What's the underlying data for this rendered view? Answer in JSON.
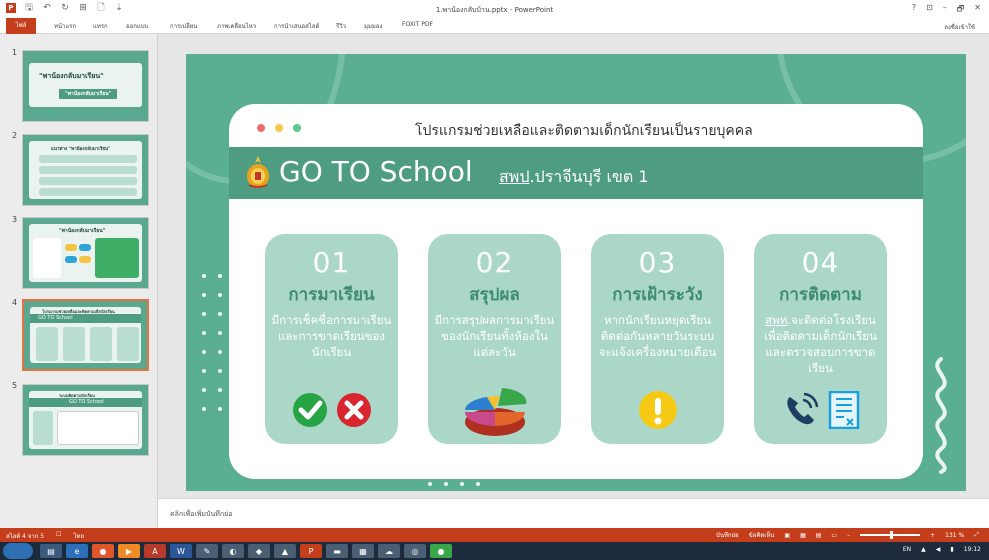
{
  "window": {
    "title": "1.พาน้องกลับบ้าน.pptx - PowerPoint",
    "help": "?",
    "restore_ribbon": "⊡",
    "minimize": "–",
    "maximize": "🗗",
    "close": "✕"
  },
  "quick_access": {
    "app_icon": "P",
    "save": "🖫",
    "undo": "↶",
    "redo": "↻",
    "present": "⊞",
    "new": "🗋",
    "customize": "⇣"
  },
  "ribbon": {
    "tabs": [
      "ไฟล์",
      "หน้าแรก",
      "แทรก",
      "ออกแบบ",
      "การเปลี่ยน",
      "ภาพเคลื่อนไหว",
      "การนำเสนอสไลด์",
      "รีวิว",
      "มุมมอง",
      "FOXIT PDF"
    ],
    "signin": "ลงชื่อเข้าใช้"
  },
  "thumbnails": [
    {
      "num": "1",
      "title": "\"พาน้องกลับมาเรียน\"",
      "sub": "\"พาน้องกลับมาเรียน\""
    },
    {
      "num": "2",
      "title": "แนวทาง \"พาน้องกลับมาเรียน\""
    },
    {
      "num": "3",
      "title": "\"พาน้องกลับมาเรียน\""
    },
    {
      "num": "4",
      "title": "โปรแกรมช่วยเหลือและติดตามเด็กนักเรียน",
      "sub": "GO TO School"
    },
    {
      "num": "5",
      "title": "ระบบติดตามนักเรียน",
      "sub": "GO TO School"
    }
  ],
  "slide": {
    "headline": "โปรแกรมช่วยเหลือและติดตามเด็กนักเรียนเป็นรายบุคคล",
    "brand": "GO TO School",
    "sub_prefix": "สพป",
    "sub_rest": ".ปราจีนบุรี เขต 1",
    "sections": [
      {
        "num": "01",
        "title": "การมาเรียน",
        "desc": "มีการเช็คชื่อการมาเรียนและการขาดเรียนของนักเรียน",
        "icons": [
          "check-icon",
          "cross-icon"
        ]
      },
      {
        "num": "02",
        "title": "สรุปผล",
        "desc": "มีการสรุปผลการมาเรียนของนักเรียนทั้งห้องในแต่ละวัน",
        "icons": [
          "pie-chart-icon"
        ]
      },
      {
        "num": "03",
        "title": "การเฝ้าระวัง",
        "desc": "หากนักเรียนหยุดเรียนติดต่อกันหลายวันระบบจะแจ้งเครื่องหมายเตือน",
        "icons": [
          "warning-icon"
        ]
      },
      {
        "num": "04",
        "title": "การติดตาม",
        "desc_prefix": "สพท",
        "desc": ".จะติดต่อโรงเรียนเพื่อติดตามเด็กนักเรียนและตรวจสอบการขาดเรียน",
        "icons": [
          "phone-icon",
          "document-icon"
        ]
      }
    ],
    "colors": {
      "bg": "#5aae92",
      "strip": "#4e9d82",
      "card": "#aad7c7",
      "dot_red": "#f06b6b",
      "dot_yellow": "#f5c64a",
      "dot_green": "#5ec98d"
    }
  },
  "notes": {
    "placeholder": "คลิกเพื่อเพิ่มบันทึกย่อ"
  },
  "status": {
    "slide": "สไลด์ 4 จาก 5",
    "lang": "ไทย",
    "notes_btn": "บันทึกย่อ",
    "comments_btn": "ข้อคิดเห็น",
    "zoom_percent": "131 %",
    "zoom_minus": "–",
    "zoom_plus": "+"
  },
  "taskbar": {
    "lang": "EN",
    "time": "19:12"
  }
}
